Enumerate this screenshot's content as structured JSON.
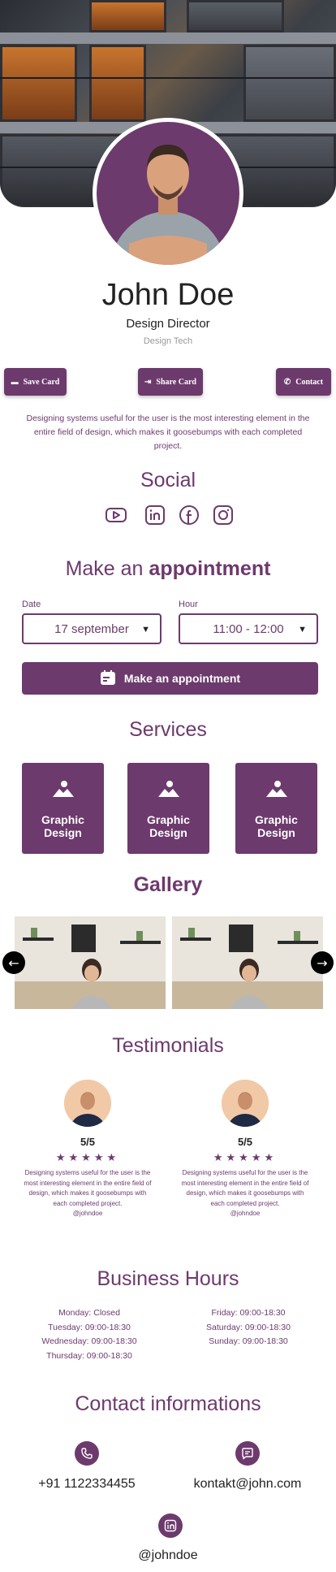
{
  "profile": {
    "name": "John Doe",
    "title": "Design Director",
    "company": "Design Tech",
    "bio": "Designing systems useful for the user is the most interesting element in the entire field of design, which makes it goosebumps with each completed project."
  },
  "actions": {
    "save_label": "Save Card",
    "share_label": "Share Card",
    "contact_label": "Contact"
  },
  "social": {
    "title": "Social",
    "icons": [
      "youtube-icon",
      "linkedin-icon",
      "facebook-icon",
      "instagram-icon"
    ]
  },
  "appointment": {
    "title_light": "Make an ",
    "title_bold": "appointment",
    "date_label": "Date",
    "date_value": "17 september",
    "hour_label": "Hour",
    "hour_value": "11:00 - 12:00",
    "button_label": "Make an appointment"
  },
  "services": {
    "title": "Services",
    "items": [
      {
        "label_line1": "Graphic",
        "label_line2": "Design",
        "icon": "image-icon"
      },
      {
        "label_line1": "Graphic",
        "label_line2": "Design",
        "icon": "image-icon"
      },
      {
        "label_line1": "Graphic",
        "label_line2": "Design",
        "icon": "image-icon"
      }
    ]
  },
  "gallery": {
    "title": "Gallery"
  },
  "testimonials": {
    "title": "Testimonials",
    "items": [
      {
        "rating": "5/5",
        "stars": "★★★★★",
        "text": "Designing systems useful for the user is the most interesting element in the entire field of design, which makes it goosebumps with each completed project.",
        "handle": "@johndoe"
      },
      {
        "rating": "5/5",
        "stars": "★★★★★",
        "text": "Designing systems useful for the user is the most interesting element in the entire field of design, which makes it goosebumps with each completed project.",
        "handle": "@johndoe"
      }
    ]
  },
  "business_hours": {
    "title": "Business Hours",
    "left": [
      "Monday: Closed",
      "Tuesday: 09:00-18:30",
      "Wednesday: 09:00-18:30",
      "Thursday: 09:00-18:30"
    ],
    "right": [
      "Friday: 09:00-18:30",
      "Saturday: 09:00-18:30",
      "Sunday: 09:00-18:30"
    ]
  },
  "contact": {
    "title": "Contact informations",
    "phone": "+91 1122334455",
    "email": "kontakt@john.com",
    "handle": "@johndoe"
  },
  "colors": {
    "accent": "#6d3a6d"
  }
}
